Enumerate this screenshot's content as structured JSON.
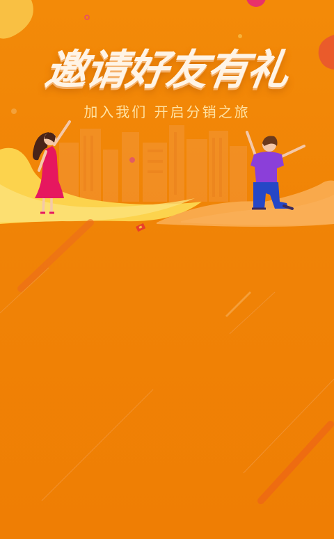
{
  "poster": {
    "title": "邀请好友有礼",
    "subtitle": "加入我们 开启分销之旅"
  },
  "colors": {
    "background": "#f08305",
    "hill_yellow": "#fcd34d",
    "hill_orange": "#f9a94b",
    "accent_red": "#e6175f",
    "accent_purple": "#8b3fd9",
    "accent_blue": "#2647c6"
  },
  "illustration": {
    "figures": [
      "woman-in-red-dress",
      "man-in-purple-shirt"
    ],
    "background": "city-skyline"
  }
}
